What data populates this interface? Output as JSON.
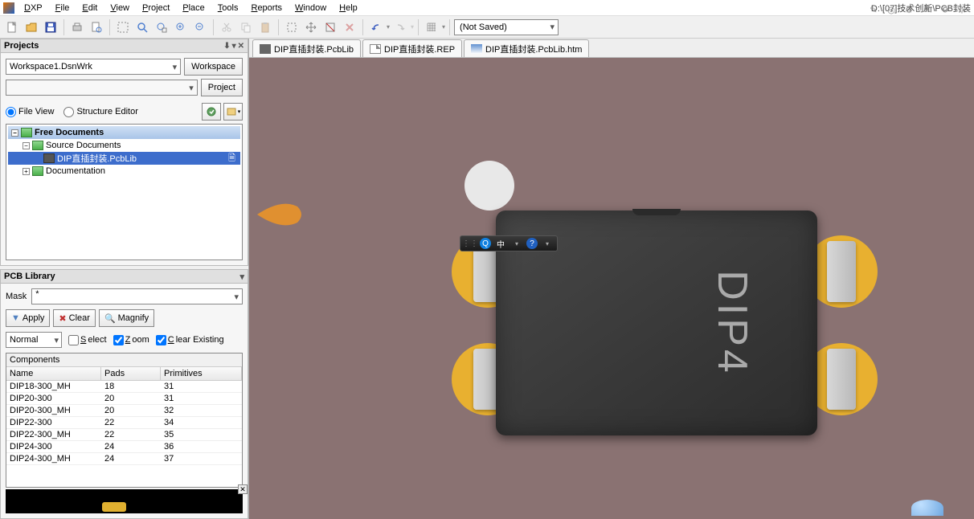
{
  "menubar": {
    "items": [
      "DXP",
      "File",
      "Edit",
      "View",
      "Project",
      "Place",
      "Tools",
      "Reports",
      "Window",
      "Help"
    ],
    "path": "D:\\[07]技术创新\\PCB封装"
  },
  "toolbar": {
    "save_status": "(Not Saved)"
  },
  "projects": {
    "title": "Projects",
    "workspace": "Workspace1.DsnWrk",
    "workspace_btn": "Workspace",
    "project_btn": "Project",
    "fileview_label": "File View",
    "structure_label": "Structure Editor",
    "tree": {
      "root": "Free Documents",
      "src": "Source Documents",
      "file": "DIP直插封装.PcbLib",
      "doc": "Documentation"
    }
  },
  "pcblib": {
    "title": "PCB Library",
    "mask_label": "Mask",
    "mask_value": "*",
    "apply": "Apply",
    "clear": "Clear",
    "magnify": "Magnify",
    "normal": "Normal",
    "select": "Select",
    "zoom": "Zoom",
    "clear_existing": "Clear Existing",
    "grid_title": "Components",
    "headers": [
      "Name",
      "Pads",
      "Primitives"
    ],
    "rows": [
      {
        "n": "DIP18-300_MH",
        "p": "18",
        "r": "31"
      },
      {
        "n": "DIP20-300",
        "p": "20",
        "r": "31"
      },
      {
        "n": "DIP20-300_MH",
        "p": "20",
        "r": "32"
      },
      {
        "n": "DIP22-300",
        "p": "22",
        "r": "34"
      },
      {
        "n": "DIP22-300_MH",
        "p": "22",
        "r": "35"
      },
      {
        "n": "DIP24-300",
        "p": "24",
        "r": "36"
      },
      {
        "n": "DIP24-300_MH",
        "p": "24",
        "r": "37"
      }
    ]
  },
  "tabs": [
    {
      "label": "DIP直插封装.PcbLib"
    },
    {
      "label": "DIP直插封装.REP"
    },
    {
      "label": "DIP直插封装.PcbLib.htm"
    }
  ],
  "viewer": {
    "chip_label": "DIP4",
    "ime_zh": "中"
  }
}
